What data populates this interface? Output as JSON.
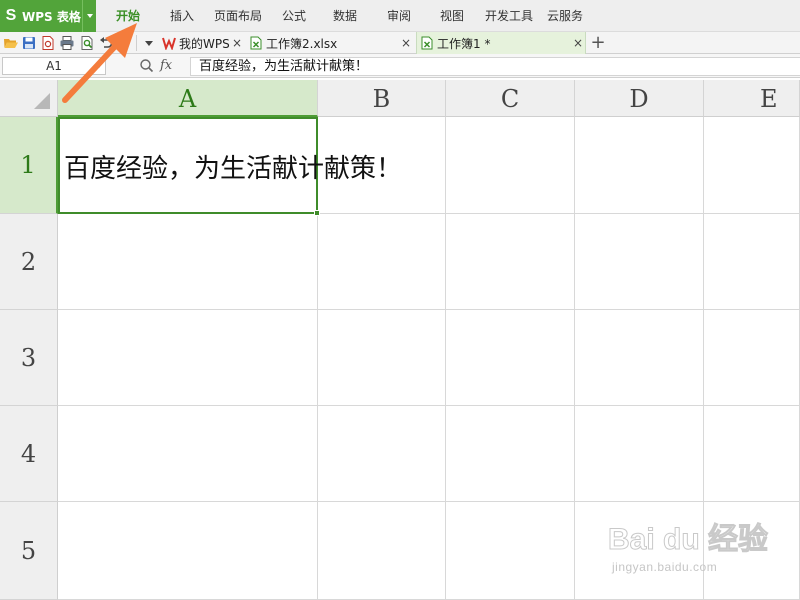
{
  "app": {
    "logo_glyph": "S",
    "name": "WPS 表格",
    "brand_color": "#52a43a"
  },
  "menu": {
    "items": [
      "开始",
      "插入",
      "页面布局",
      "公式",
      "数据",
      "审阅",
      "视图",
      "开发工具",
      "云服务"
    ],
    "active": "开始"
  },
  "quick_access": {
    "icons": [
      "open-folder-icon",
      "save-icon",
      "export-pdf-icon",
      "print-icon",
      "print-preview-icon",
      "undo-icon",
      "redo-icon"
    ]
  },
  "tabs": {
    "items": [
      {
        "label": "我的WPS",
        "icon": "wps-logo-icon",
        "close": "×"
      },
      {
        "label": "工作簿2.xlsx",
        "icon": "spreadsheet-file-icon",
        "close": "×"
      },
      {
        "label": "工作簿1 *",
        "icon": "spreadsheet-file-icon",
        "close": "×",
        "active": true
      }
    ],
    "new_tab": "+"
  },
  "formula_bar": {
    "cell_reference": "A1",
    "fx_label": "fx",
    "formula": "百度经验，为生活献计献策！"
  },
  "sheet": {
    "columns": [
      "A",
      "B",
      "C",
      "D",
      "E"
    ],
    "rows": [
      "1",
      "2",
      "3",
      "4",
      "5"
    ],
    "selected_cell": "A1",
    "cells": {
      "A1": "百度经验，为生活献计献策！"
    },
    "selection_color": "#3f8c2a"
  },
  "annotation": {
    "arrow_color": "#f47c3c"
  },
  "watermark": {
    "brand": "Bai du 经验",
    "url": "jingyan.baidu.com"
  }
}
